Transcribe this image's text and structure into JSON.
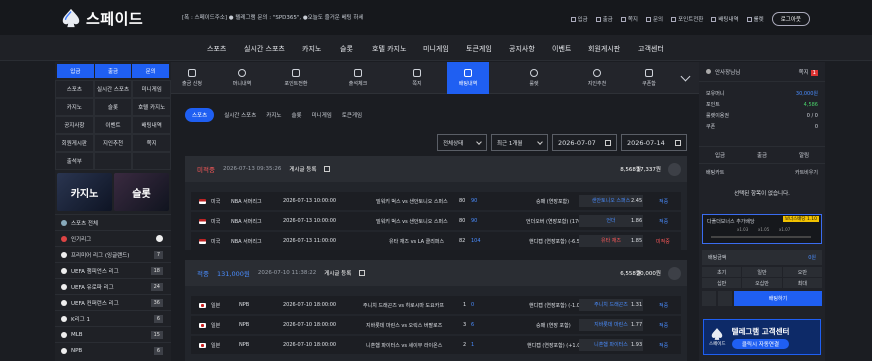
{
  "header": {
    "logo_text": "스페이드",
    "notice": "[폭 : 스페이드주소] ● 텔레그램 문의 : \"SPD365\", ●오늘도 즐거운 베팅 하세",
    "top_links": [
      "입금",
      "출금",
      "쪽지",
      "문의",
      "포인트전환",
      "배팅내역",
      "룰렛"
    ],
    "logout_label": "로그아웃"
  },
  "main_nav": [
    "스포츠",
    "실시간 스포츠",
    "카지노",
    "슬롯",
    "호텔 카지노",
    "미니게임",
    "토큰게임",
    "공지사항",
    "이벤트",
    "회원게시판",
    "고객센터"
  ],
  "left": {
    "top_buttons": [
      "입금",
      "출금",
      "문의"
    ],
    "grid": [
      "스포츠",
      "실시간 스포츠",
      "미니게임",
      "카지노",
      "슬롯",
      "호텔 카지노",
      "공지사항",
      "이벤트",
      "배팅내역",
      "회원게시판",
      "지인추천",
      "쪽지",
      "출석부",
      "",
      ""
    ],
    "banners": [
      "카지노",
      "슬롯"
    ],
    "sports_all": "스포츠 전체",
    "popular": "인기리그",
    "leagues": [
      {
        "name": "프리미어 리그 (잉글랜드)",
        "count": "7"
      },
      {
        "name": "UEFA 챔피언스 리그",
        "count": "18"
      },
      {
        "name": "UEFA 유로파 리그",
        "count": "24"
      },
      {
        "name": "UEFA 컨퍼런스 리그",
        "count": "36"
      },
      {
        "name": "K리그 1",
        "count": "6"
      },
      {
        "name": "MLB",
        "count": "15"
      },
      {
        "name": "NPB",
        "count": "6"
      }
    ]
  },
  "icon_nav": [
    {
      "label": "출금 신청",
      "icon": "wallet-icon"
    },
    {
      "label": "머니내역",
      "icon": "clock-icon"
    },
    {
      "label": "포인트전환",
      "icon": "exchange-icon"
    },
    {
      "label": "출석체크",
      "icon": "calendar-icon"
    },
    {
      "label": "쪽지",
      "icon": "mail-icon"
    },
    {
      "label": "배팅내역",
      "icon": "list-icon"
    },
    {
      "label": "룰렛",
      "icon": "roulette-icon"
    },
    {
      "label": "지인추천",
      "icon": "user-add-icon"
    },
    {
      "label": "쿠폰함",
      "icon": "coupon-icon"
    }
  ],
  "sub_tabs": [
    "스포츠",
    "실시간 스포츠",
    "카지노",
    "슬롯",
    "미니게임",
    "토큰게임"
  ],
  "filters": {
    "status": "전체상태",
    "period": "최근 1개월",
    "start_date": "2026-07-07",
    "end_date": "2026-07-14"
  },
  "bets": [
    {
      "status": "미적중",
      "amount": "",
      "date": "2026-07-13 09:35:26",
      "register_label": "게시글 등록",
      "bet_amount": "8,568원",
      "win_amount": "17,337원",
      "rows": [
        {
          "country": "미국",
          "league": "NBA 서머리그",
          "time": "2026-07-13 10:00:00",
          "match": "밀워키 벅스 vs 샌안토니오 스퍼스",
          "score_home": "80",
          "score_away": "90",
          "market": "승패 (연장포함)",
          "pick": "샌안토니오 스퍼스",
          "odds": "2.45",
          "result": "적중"
        },
        {
          "country": "미국",
          "league": "NBA 서머리그",
          "time": "2026-07-13 10:00:00",
          "match": "밀워키 벅스 vs 샌안토니오 스퍼스",
          "score_home": "80",
          "score_away": "90",
          "market": "언더오버 (연장포함) (176.5)",
          "pick": "언더",
          "odds": "1.86",
          "result": "적중"
        },
        {
          "country": "미국",
          "league": "NBA 서머리그",
          "time": "2026-07-13 11:00:00",
          "match": "유타 재즈 vs LA 클리퍼스",
          "score_home": "82",
          "score_away": "104",
          "market": "핸디캡 (연장포함) (-6.5)",
          "pick": "유타 재즈",
          "odds": "1.85",
          "result": "미적중"
        }
      ]
    },
    {
      "status": "적중",
      "amount": "131,000원",
      "date": "2026-07-10 11:38:22",
      "register_label": "게시글 등록",
      "bet_amount": "6,558원",
      "win_amount": "20,000원",
      "rows": [
        {
          "country": "일본",
          "league": "NPB",
          "time": "2026-07-10 18:00:00",
          "match": "주니치 드래곤즈 vs 히로시마 도요카프",
          "score_home": "1",
          "score_away": "0",
          "market": "핸디캡 (연장포함) (-1.0)",
          "pick": "주니치 드래곤즈",
          "odds": "1.31",
          "result": "적중"
        },
        {
          "country": "일본",
          "league": "NPB",
          "time": "2026-07-10 18:00:00",
          "match": "지바롯데 마린스 vs 오릭스 버팔로즈",
          "score_home": "3",
          "score_away": "6",
          "market": "승패 (연장 포함)",
          "pick": "지바롯데 마린스",
          "odds": "1.77",
          "result": "적중"
        },
        {
          "country": "일본",
          "league": "NPB",
          "time": "2026-07-10 18:00:00",
          "match": "니혼햄 파이터스 vs 세이부 라이온스",
          "score_home": "2",
          "score_away": "1",
          "market": "핸디캡 (연장포함) (+1.0)",
          "pick": "니혼햄 파이터스",
          "odds": "1.93",
          "result": "적중"
        }
      ]
    }
  ],
  "right": {
    "title": "안사장님님",
    "mail_label": "쪽지",
    "mail_count": "1",
    "money_label": "보유머니",
    "money": "30,000원",
    "point_label": "포인트",
    "point": "4,586",
    "roulette_label": "룰렛이용권",
    "roulette": "0 / 0",
    "coupon_label": "쿠폰",
    "coupon": "0",
    "buttons": [
      "입금",
      "출금",
      "알림"
    ],
    "betcart_label": "배팅카트",
    "clear_label": "카트비우기",
    "empty_msg": "선택된 항목이 없습니다.",
    "folder_label": "다폴더보너스 추가배당",
    "folder_badge": "보너스배당 1.10",
    "folder_ticks": [
      "x1.03",
      "x1.05",
      "x1.07"
    ],
    "bet_amount_label": "배팅금액",
    "bet_amount_value": "0원",
    "chips": [
      "초기",
      "일만",
      "오만",
      "십만",
      "오십만",
      "최대"
    ],
    "bet_button": "배팅하기",
    "ad_line1": "텔레그램 고객센터",
    "ad_line2": "클릭시 자동연결",
    "ad_brand": "스페이드"
  }
}
